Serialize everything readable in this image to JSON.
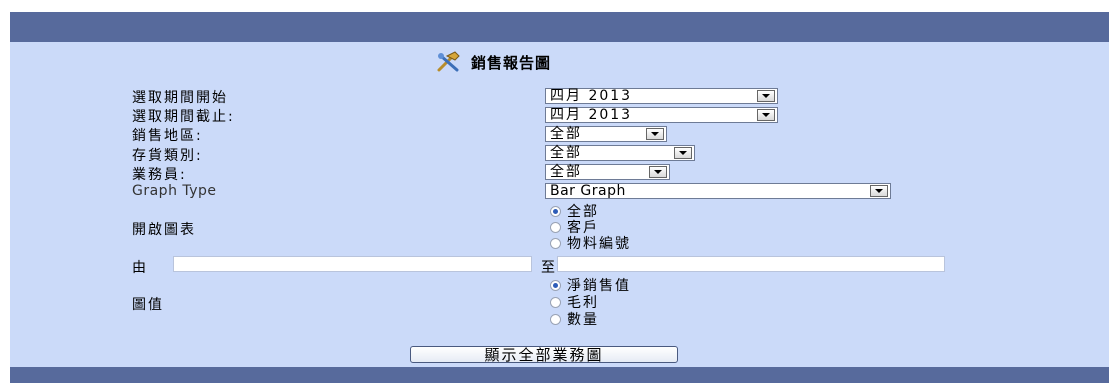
{
  "title": "銷售報告圖",
  "labels": {
    "period_start": "選取期間開始",
    "period_end": "選取期間截止:",
    "region": "銷售地區:",
    "stock_category": "存貨類別:",
    "salesperson": "業務員:",
    "graph_type": "Graph Type",
    "open_chart": "開啟圖表",
    "from": "由",
    "to": "至",
    "chart_value": "圖值"
  },
  "selects": {
    "period_start": "四月 2013",
    "period_end": "四月 2013",
    "region": "全部",
    "stock_category": "全部",
    "salesperson": "全部",
    "graph_type": "Bar Graph"
  },
  "open_chart_options": [
    {
      "label": "全部",
      "selected": true
    },
    {
      "label": "客戶",
      "selected": false
    },
    {
      "label": "物料編號",
      "selected": false
    }
  ],
  "chart_value_options": [
    {
      "label": "淨銷售值",
      "selected": true
    },
    {
      "label": "毛利",
      "selected": false
    },
    {
      "label": "數量",
      "selected": false
    }
  ],
  "inputs": {
    "from_value": "",
    "to_value": ""
  },
  "button_label": "顯示全部業務圖",
  "colors": {
    "header_bar": "#576a9c",
    "panel": "#cbdaf9",
    "radio_selected": "#2e5db8"
  },
  "icons": {
    "title_icon": "tools-icon"
  }
}
